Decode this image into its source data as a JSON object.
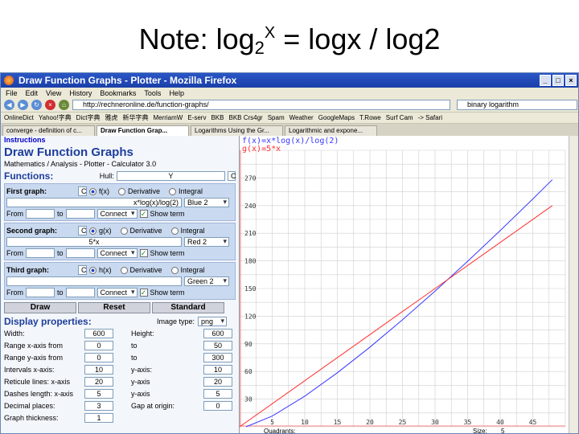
{
  "slide": {
    "title_prefix": "Note: log",
    "title_sub": "2",
    "title_sup": "X",
    "title_suffix": " = logx / log2"
  },
  "window": {
    "title": "Draw Function Graphs - Plotter - Mozilla Firefox"
  },
  "menu": [
    "File",
    "Edit",
    "View",
    "History",
    "Bookmarks",
    "Tools",
    "Help"
  ],
  "nav": {
    "url": "http://rechneronline.de/function-graphs/",
    "search": "binary logarithm"
  },
  "bookmarks": [
    "OnlineDict",
    "Yahoo!字典",
    "Dict字典",
    "雅虎",
    "新华字典",
    "MerriamW",
    "E-serv",
    "BKB",
    "BKB Crs4gr",
    "Spam",
    "Weather",
    "GoogleMaps",
    "T.Rowe",
    "Surf Cam",
    "-> Safari"
  ],
  "tabs": [
    "converge - definition of c...",
    "Draw Function Grap...",
    "Logarithms Using the Gr...",
    "Logarithmic and expone..."
  ],
  "panel": {
    "instructions": "Instructions",
    "heading": "Draw Function Graphs",
    "subheading": "Mathematics / Analysis - Plotter - Calculator 3.0",
    "functions_label": "Functions:",
    "hull_label": "Hull:",
    "hull_value": "Y",
    "graph1": {
      "label": "First graph:",
      "fn": "f(x)",
      "deriv": "Derivative",
      "integ": "Integral",
      "expr": "x*log(x)/log(2)",
      "color": "Blue 2",
      "from": "From",
      "to": "to",
      "connect": "Connect",
      "show": "Show term"
    },
    "graph2": {
      "label": "Second graph:",
      "fn": "g(x)",
      "deriv": "Derivative",
      "integ": "Integral",
      "expr": "5*x",
      "color": "Red 2",
      "from": "From",
      "to": "to",
      "connect": "Connect",
      "show": "Show term"
    },
    "graph3": {
      "label": "Third graph:",
      "fn": "h(x)",
      "deriv": "Derivative",
      "integ": "Integral",
      "expr": "",
      "color": "Green 2",
      "from": "From",
      "to": "to",
      "connect": "Connect",
      "show": "Show term"
    },
    "buttons": {
      "draw": "Draw",
      "reset": "Reset",
      "standard": "Standard"
    },
    "display_label": "Display properties:",
    "image_type_label": "Image type:",
    "image_type": "png",
    "props": [
      [
        "Width:",
        "600",
        "Height:",
        "600"
      ],
      [
        "Range x-axis from",
        "0",
        "to",
        "50"
      ],
      [
        "Range y-axis from",
        "0",
        "to",
        "300"
      ],
      [
        "Intervals x-axis:",
        "10",
        "y-axis:",
        "10"
      ],
      [
        "Reticule lines: x-axis",
        "20",
        "y-axis",
        "20"
      ],
      [
        "Dashes length: x-axis",
        "5",
        "y-axis",
        "5"
      ],
      [
        "Decimal places:",
        "3",
        "Gap at origin:",
        "0"
      ],
      [
        "Graph thickness:",
        "1",
        "",
        ""
      ]
    ]
  },
  "plot": {
    "legend1": "f(x)=x*log(x)/log(2)",
    "legend2": "g(x)=5*x",
    "bottom_labels": {
      "quadrants": "Quadrants:",
      "size": "Size:",
      "size_value": "5"
    },
    "colors": {
      "f": "#3838ff",
      "g": "#ff3030",
      "axis": "#ff8080",
      "grid": "#cfcfcf"
    }
  },
  "chart_data": {
    "type": "line",
    "x_ticks": [
      5,
      10,
      15,
      20,
      25,
      30,
      35,
      40,
      45
    ],
    "y_ticks": [
      30,
      60,
      90,
      120,
      150,
      180,
      210,
      240,
      270
    ],
    "xlim": [
      0,
      50
    ],
    "ylim": [
      0,
      300
    ],
    "series": [
      {
        "name": "f(x)=x*log(x)/log(2)",
        "x": [
          1,
          5,
          10,
          15,
          20,
          25,
          30,
          35,
          40,
          45,
          48
        ],
        "y": [
          0,
          11.6,
          33.2,
          58.6,
          86.4,
          116.1,
          147.2,
          179.5,
          212.9,
          247.1,
          268.1
        ]
      },
      {
        "name": "g(x)=5*x",
        "x": [
          0,
          10,
          20,
          30,
          40,
          48
        ],
        "y": [
          0,
          50,
          100,
          150,
          200,
          240
        ]
      }
    ],
    "grid": true
  }
}
